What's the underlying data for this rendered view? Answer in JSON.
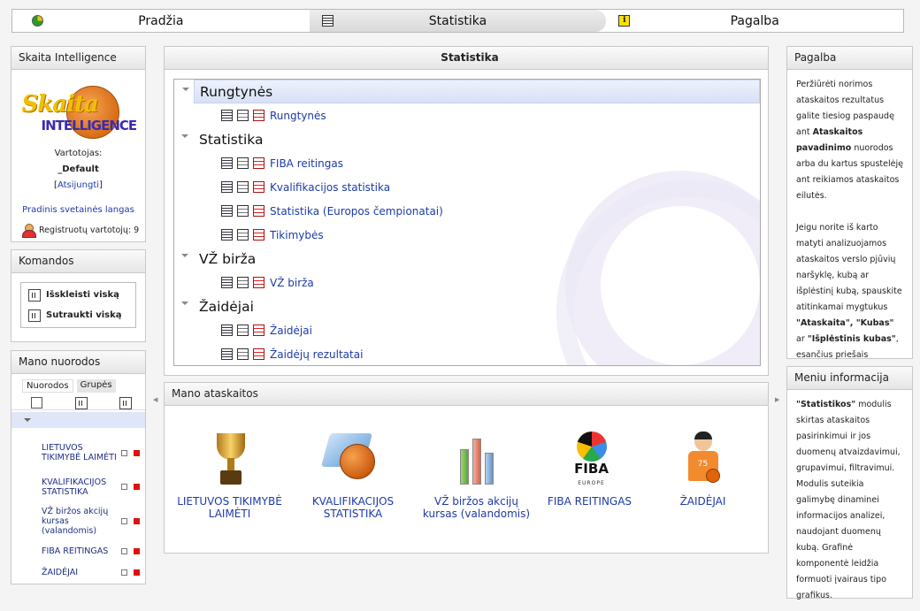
{
  "topnav": {
    "tabs": [
      {
        "label": "Pradžia",
        "icon": "home-icon"
      },
      {
        "label": "Statistika",
        "icon": "statistics-icon"
      },
      {
        "label": "Pagalba",
        "icon": "info-icon"
      }
    ]
  },
  "left": {
    "skaita": {
      "title": "Skaita Intelligence",
      "logo_text": [
        "Skaita",
        "INTELLIGENCE"
      ],
      "user_label": "Vartotojas:",
      "user_name": "_Default",
      "logout_open": "[",
      "logout_label": "Atsijungti",
      "logout_close": "]",
      "home_link": "Pradinis svetainės langas",
      "registered_label": "Registruotų vartotojų: 9"
    },
    "komandos": {
      "title": "Komandos",
      "expand_all": "Išskleisti viską",
      "collapse_all": "Sutraukti viską"
    },
    "nuorodos": {
      "title": "Mano nuorodos",
      "tab_links": "Nuorodos",
      "tab_groups": "Grupės",
      "items": [
        "LIETUVOS TIKIMYBĖ LAIMĖTI",
        "KVALIFIKACIJOS STATISTIKA",
        "VŽ biržos akcijų kursas (valandomis)",
        "FIBA REITINGAS",
        "ŽAIDĖJAI"
      ]
    }
  },
  "statistika": {
    "title": "Statistika",
    "groups": [
      {
        "label": "Rungtynės",
        "reports": [
          "Rungtynės"
        ]
      },
      {
        "label": "Statistika",
        "reports": [
          "FIBA reitingas",
          "Kvalifikacijos statistika",
          "Statistika (Europos čempionatai)",
          "Tikimybės"
        ]
      },
      {
        "label": "VŽ birža",
        "reports": [
          "VŽ birža"
        ]
      },
      {
        "label": "Žaidėjai",
        "reports": [
          "Žaidėjai",
          "Žaidėjų rezultatai"
        ]
      }
    ]
  },
  "ataskaitos": {
    "title": "Mano ataskaitos",
    "tiles": [
      {
        "label": "LIETUVOS TIKIMYBĖ LAIMĖTI",
        "icon": "trophy-icon"
      },
      {
        "label": "KVALIFIKACIJOS STATISTIKA",
        "icon": "basketball-icon"
      },
      {
        "label": "VŽ biržos akcijų kursas (valandomis)",
        "icon": "bar-chart-icon"
      },
      {
        "label": "FIBA REITINGAS",
        "icon": "fiba-logo-icon",
        "logo_text": "FIBA",
        "logo_sub": "EUROPE"
      },
      {
        "label": "ŽAIDĖJAI",
        "icon": "player-icon",
        "jersey": "75"
      }
    ]
  },
  "right": {
    "pagalba": {
      "title": "Pagalba",
      "p1_a": "Peržiūrėti norimos ataskaitos rezultatus galite tiesiog paspaudę ant ",
      "p1_b": "Ataskaitos pavadinimo",
      "p1_c": " nuorodos arba du kartus spustelėję ant reikiamos ataskaitos eilutės.",
      "p2_a": "Jeigu norite iš karto matyti analizuojamos ataskaitos verslo pjūvių naršyklę, kubą ar išplėstinį kubą, spauskite atitinkamai mygtukus ",
      "p2_b": "\"Ataskaita\", \"Kubas\"",
      "p2_c": " ar ",
      "p2_d": "\"Išplėstinis kubas\"",
      "p2_e": ", esančius priešais ataskaitos nuorodą."
    },
    "meniu": {
      "title": "Meniu informacija",
      "b": "\"Statistikos\"",
      "text": " modulis skirtas ataskaitos pasirinkimui ir jos duomenų atvaizdavimui, grupavimui, filtravimui. Modulis suteikia galimybę dinaminei informacijos analizei, naudojant duomenų kubą. Grafinė komponentė leidžia formuoti įvairaus tipo grafikus."
    }
  },
  "colors": {
    "link": "#1d3aa8",
    "highlight": "#dfe6f7",
    "accent_red": "#e01010"
  }
}
